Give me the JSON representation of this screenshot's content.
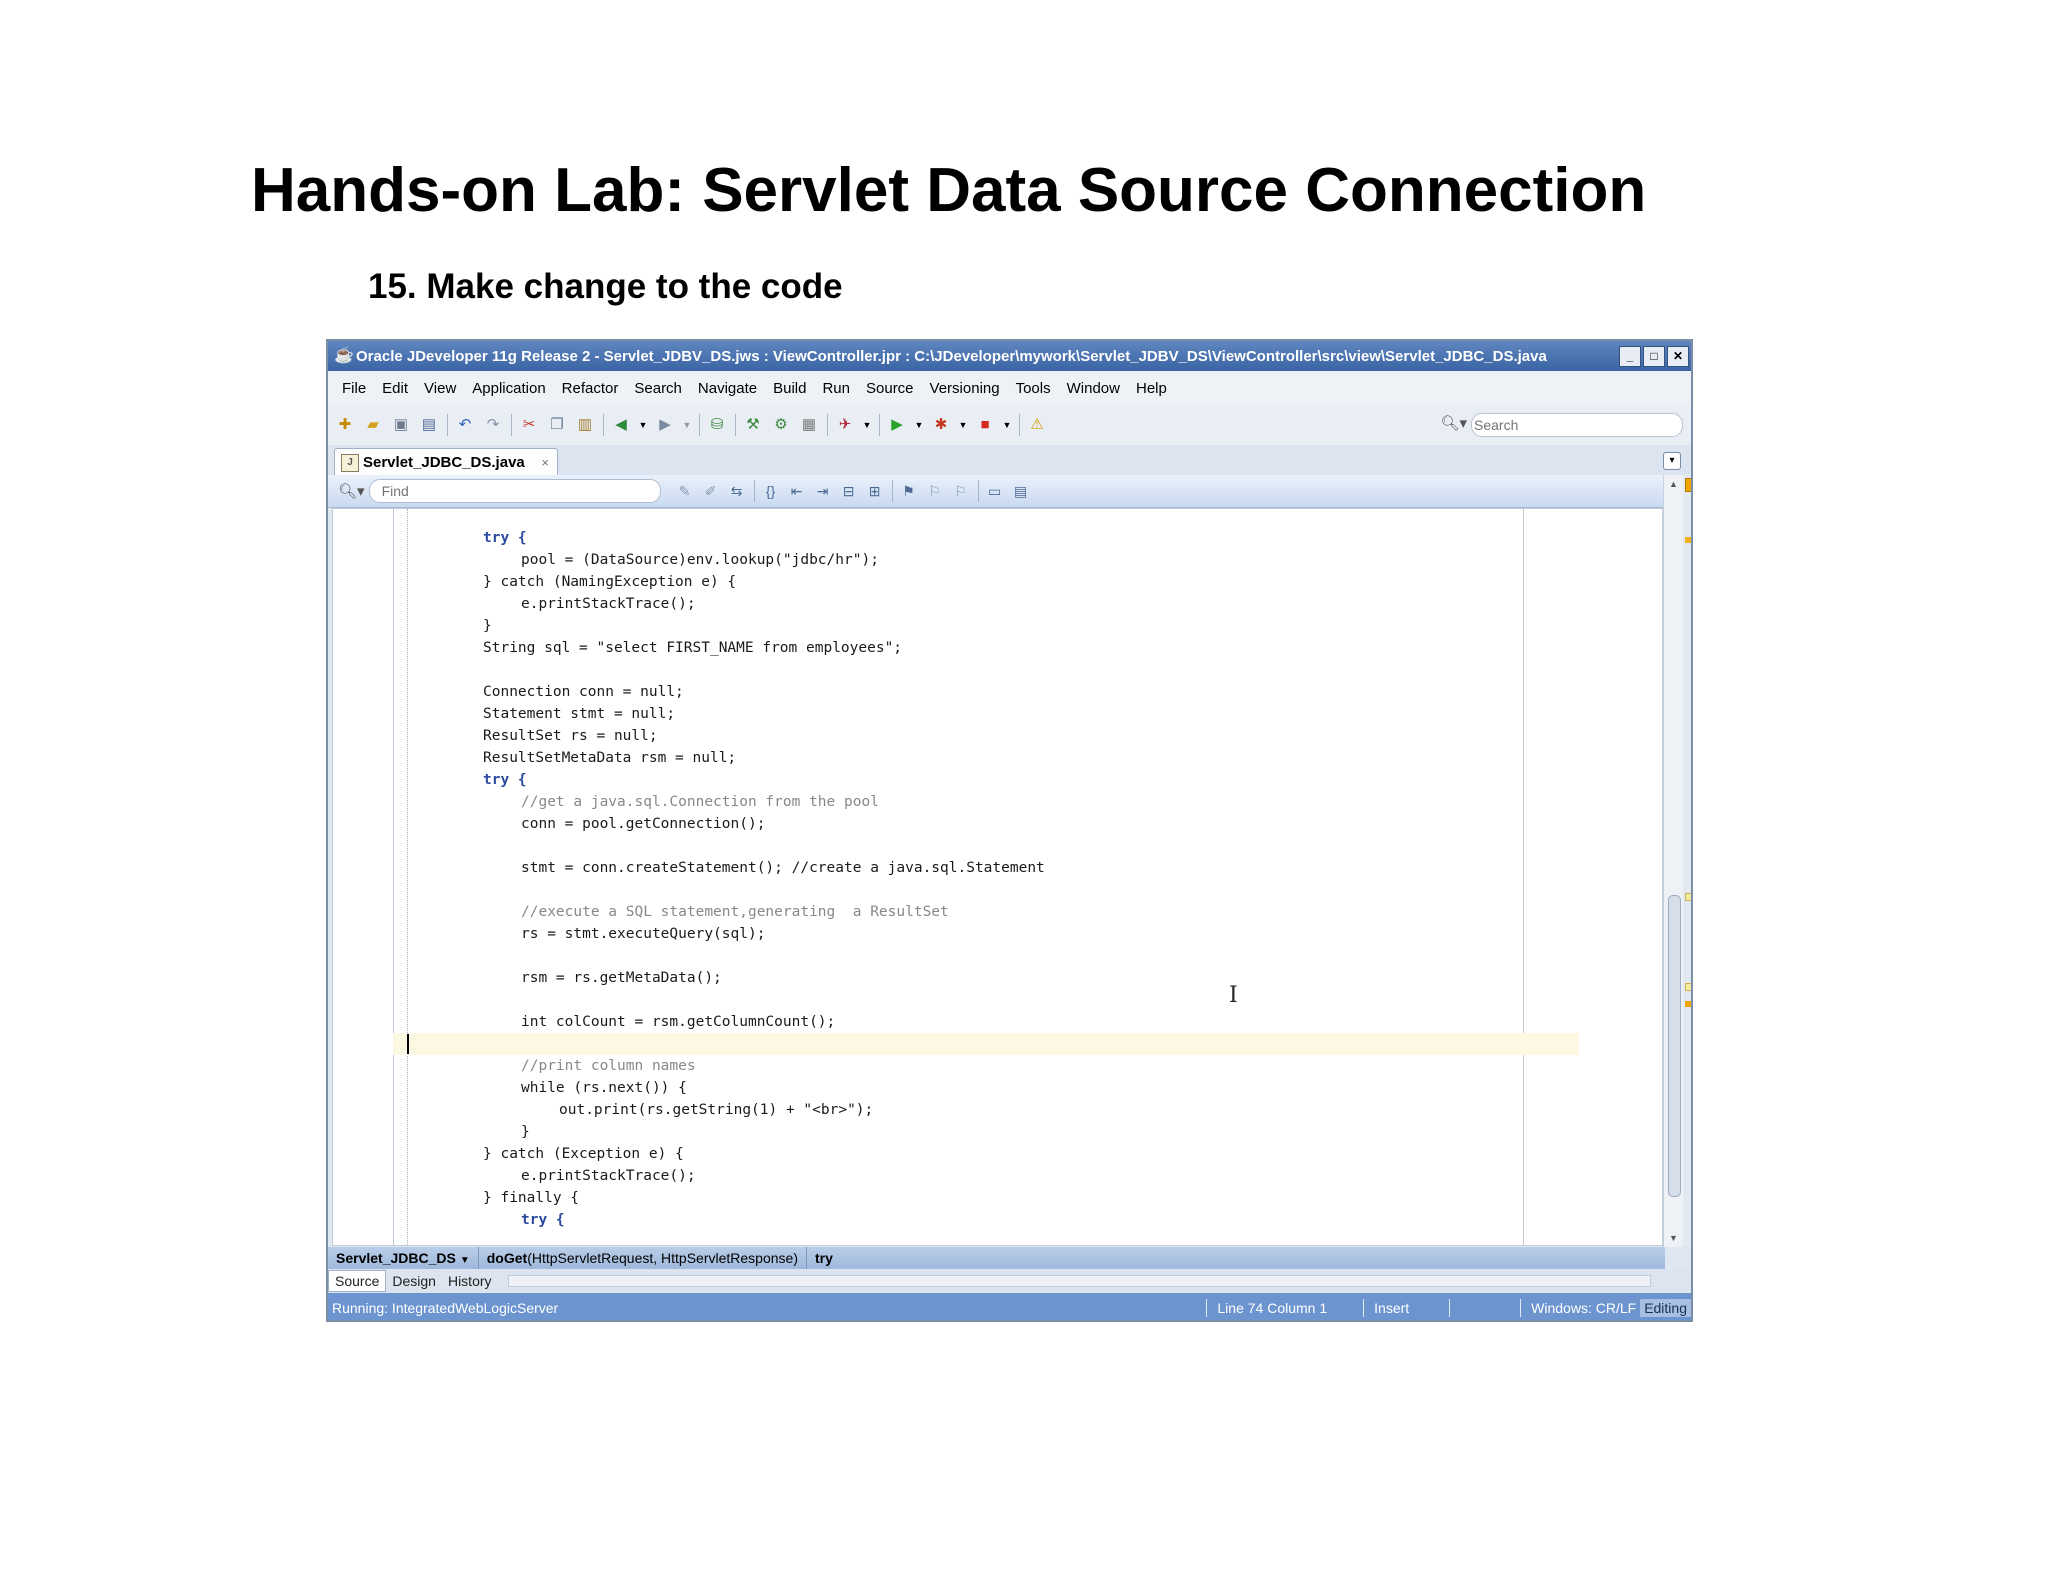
{
  "slide": {
    "title": "Hands-on Lab: Servlet Data Source Connection",
    "step": "15. Make change to the code"
  },
  "window": {
    "title": "Oracle JDeveloper 11g Release 2 - Servlet_JDBV_DS.jws : ViewController.jpr : C:\\JDeveloper\\mywork\\Servlet_JDBV_DS\\ViewController\\src\\view\\Servlet_JDBC_DS.java",
    "buttons": {
      "minimize": "_",
      "maximize": "□",
      "close": "✕"
    }
  },
  "menu": [
    "File",
    "Edit",
    "View",
    "Application",
    "Refactor",
    "Search",
    "Navigate",
    "Build",
    "Run",
    "Source",
    "Versioning",
    "Tools",
    "Window",
    "Help"
  ],
  "toolbar": {
    "search_placeholder": "Search"
  },
  "editor_tab": {
    "label": "Servlet_JDBC_DS.java",
    "close": "×"
  },
  "findbar": {
    "placeholder": "Find"
  },
  "code_lines": [
    "try {",
    "pool = (DataSource)env.lookup(\"jdbc/hr\");",
    "} catch (NamingException e) {",
    "e.printStackTrace();",
    "}",
    "String sql = \"select FIRST_NAME from employees\";",
    "Connection conn = null;",
    "Statement stmt = null;",
    "ResultSet rs = null;",
    "ResultSetMetaData rsm = null;",
    "try {",
    "//get a java.sql.Connection from the pool",
    "conn = pool.getConnection();",
    "stmt = conn.createStatement(); //create a java.sql.Statement",
    "//execute a SQL statement,generating  a ResultSet",
    "rs = stmt.executeQuery(sql);",
    "rsm = rs.getMetaData();",
    "int colCount = rsm.getColumnCount();",
    "//print column names",
    "while (rs.next()) {",
    "out.print(rs.getString(1) + \"<br>\");",
    "}",
    "} catch (Exception e) {",
    "e.printStackTrace();",
    "} finally {",
    "try {"
  ],
  "breadcrumbs": {
    "class_name": "Servlet_JDBC_DS",
    "method_name": "doGet",
    "method_params": "(HttpServletRequest, HttpServletResponse)",
    "block": "try"
  },
  "bottom_tabs": [
    "Source",
    "Design",
    "History"
  ],
  "status": {
    "left": "Running: IntegratedWebLogicServer",
    "position": "Line 74 Column 1",
    "mode": "Insert",
    "line_endings": "Windows: CR/LF",
    "state": "Editing"
  }
}
